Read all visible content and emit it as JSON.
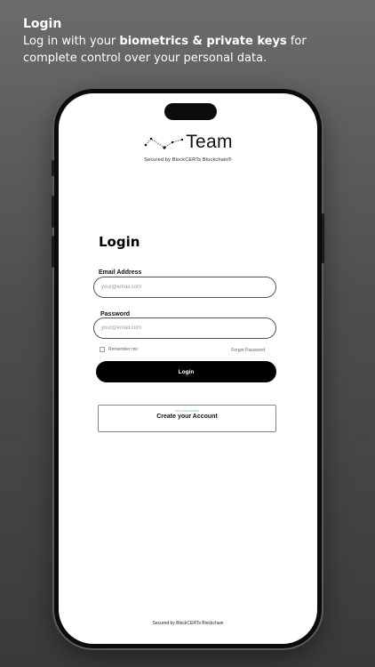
{
  "promo": {
    "title": "Login",
    "line_prefix": "Log in with your ",
    "line_bold": "biometrics & private keys",
    "line_suffix": " for complete control over your personal data."
  },
  "app": {
    "logo_word": "Team",
    "logo_subtitle": "Secured by BlockCERTs Blockchain®"
  },
  "login": {
    "title": "Login",
    "email_label": "Email Address",
    "email_placeholder": "your@email.com",
    "password_label": "Password",
    "password_placeholder": "your@email.com",
    "remember_label": "Remember me",
    "forgot_label": "Forgot Password",
    "login_button": "Login"
  },
  "create_account": {
    "hint": "New to BlockCERTs",
    "label": "Create your Account"
  },
  "footer": {
    "text": "Secured by BlockCERTs Blockchain"
  },
  "colors": {
    "background_top": "#6b6b6b",
    "background_bottom": "#3a3a3a",
    "primary_button": "#000000",
    "screen": "#ffffff"
  }
}
